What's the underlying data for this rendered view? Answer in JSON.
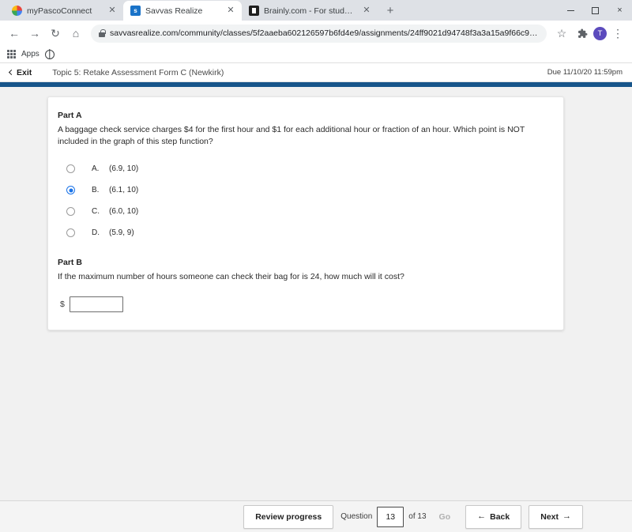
{
  "browser": {
    "tabs": [
      {
        "title": "myPascoConnect",
        "favicon": "pasco-circle-icon",
        "active": false
      },
      {
        "title": "Savvas Realize",
        "favicon": "savvas-s-icon",
        "active": true
      },
      {
        "title": "Brainly.com - For students. By stu",
        "favicon": "brainly-icon",
        "active": false
      }
    ],
    "new_tab_label": "+",
    "window_controls": {
      "minimize": "minimize",
      "maximize": "maximize",
      "close": "×"
    },
    "nav": {
      "back": "←",
      "forward": "→",
      "reload": "↻",
      "home": "⌂"
    },
    "url": "savvasrealize.com/community/classes/5f2aaeba602126597b6fd4e9/assignments/24ff9021d94748f3a3a15a9f66c94722/content/f00d...",
    "toolbar_icons": {
      "bookmark_star": "☆",
      "extensions": "puzzle",
      "menu": "⋮"
    },
    "profile_initial": "T",
    "bookmarks": {
      "apps_label": "Apps"
    }
  },
  "app": {
    "exit_label": "Exit",
    "assignment_title": "Topic 5: Retake Assessment Form C (Newkirk)",
    "due_text": "Due 11/10/20 11:59pm",
    "accent_color": "#17558a"
  },
  "question": {
    "part_a": {
      "label": "Part A",
      "text": "A baggage check service charges $4 for the first hour and $1 for each additional hour or fraction of an hour. Which point is NOT included in the graph of this step function?",
      "options": [
        {
          "letter": "A.",
          "text": "(6.9, 10)",
          "selected": false
        },
        {
          "letter": "B.",
          "text": "(6.1, 10)",
          "selected": true
        },
        {
          "letter": "C.",
          "text": "(6.0, 10)",
          "selected": false
        },
        {
          "letter": "D.",
          "text": "(5.9, 9)",
          "selected": false
        }
      ]
    },
    "part_b": {
      "label": "Part B",
      "text": "If the maximum number of hours someone can check their bag for is 24, how much will it cost?",
      "currency_symbol": "$",
      "answer_value": "",
      "answer_placeholder": ""
    }
  },
  "footer": {
    "review_label": "Review progress",
    "question_label": "Question",
    "current_question": "13",
    "of_label": "of 13",
    "go_label": "Go",
    "back_label": "Back",
    "next_label": "Next",
    "back_arrow": "←",
    "next_arrow": "→"
  }
}
